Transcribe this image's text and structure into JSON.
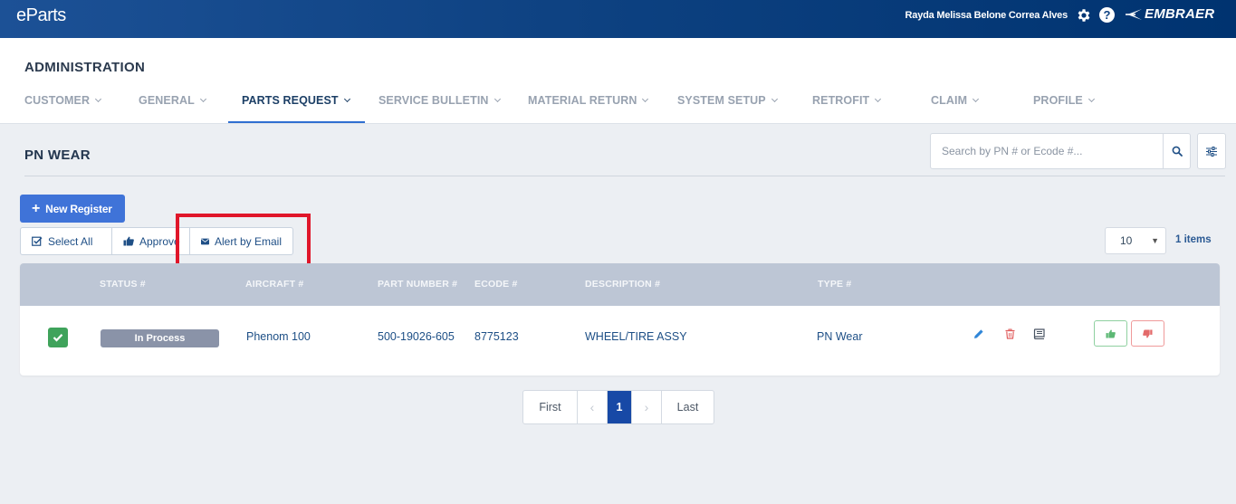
{
  "app": {
    "logo": "eParts",
    "user_name": "Rayda Melissa Belone Correa Alves",
    "brand": "EMBRAER"
  },
  "header": {
    "title": "ADMINISTRATION",
    "nav": [
      {
        "label": "CUSTOMER",
        "active": false
      },
      {
        "label": "GENERAL",
        "active": false
      },
      {
        "label": "PARTS REQUEST",
        "active": true
      },
      {
        "label": "SERVICE BULLETIN",
        "active": false
      },
      {
        "label": "MATERIAL RETURN",
        "active": false
      },
      {
        "label": "SYSTEM SETUP",
        "active": false
      },
      {
        "label": "RETROFIT",
        "active": false
      },
      {
        "label": "CLAIM",
        "active": false
      },
      {
        "label": "PROFILE",
        "active": false
      }
    ]
  },
  "page": {
    "title": "PN WEAR",
    "search_placeholder": "Search by PN # or Ecode #..."
  },
  "toolbar": {
    "new_label": "New Register",
    "select_all_label": "Select All",
    "approve_label": "Approve",
    "alert_label": "Alert by Email",
    "page_size": "10",
    "items_count": "1 items"
  },
  "table": {
    "columns": [
      "STATUS #",
      "AIRCRAFT #",
      "PART NUMBER #",
      "ECODE #",
      "DESCRIPTION #",
      "TYPE #"
    ],
    "rows": [
      {
        "checked": true,
        "status": "In Process",
        "aircraft": "Phenom 100",
        "part_number": "500-19026-605",
        "ecode": "8775123",
        "description": "WHEEL/TIRE ASSY",
        "type": "PN Wear"
      }
    ]
  },
  "pagination": {
    "first": "First",
    "prev": "‹",
    "current": "1",
    "next": "›",
    "last": "Last"
  },
  "colors": {
    "topbar": "#0e4282",
    "primary": "#3f73d8",
    "highlight": "#e0162a",
    "status_badge": "#8a93a8",
    "check_green": "#3fa35b"
  },
  "icons": [
    "settings-gear-icon",
    "help-icon",
    "embraer-logo-icon",
    "search-icon",
    "filter-sliders-icon",
    "plus-icon",
    "check-square-icon",
    "thumbs-up-icon",
    "envelope-icon",
    "pencil-icon",
    "trash-icon",
    "book-icon",
    "thumbs-down-icon"
  ]
}
